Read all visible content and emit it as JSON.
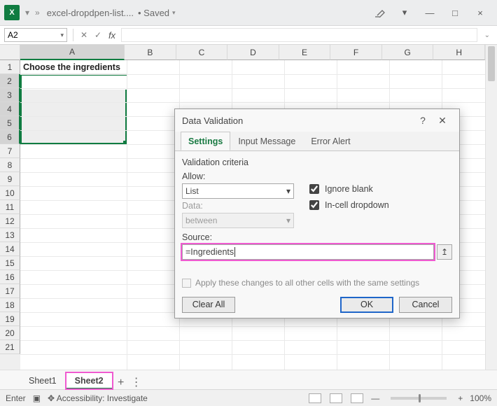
{
  "titlebar": {
    "filename": "excel-dropdpen-list....",
    "status": "Saved"
  },
  "titlebuttons": {
    "min": "—",
    "max": "□",
    "close": "×"
  },
  "namebox": "A2",
  "columns": [
    "A",
    "B",
    "C",
    "D",
    "E",
    "F",
    "G",
    "H"
  ],
  "cellA1": "Choose the ingredients",
  "tabs": {
    "sheet1": "Sheet1",
    "sheet2": "Sheet2"
  },
  "status": {
    "mode": "Enter",
    "access": "Accessibility: Investigate",
    "zoom": "100%"
  },
  "dlg": {
    "title": "Data Validation",
    "tabs": {
      "settings": "Settings",
      "input": "Input Message",
      "error": "Error Alert"
    },
    "criteria": "Validation criteria",
    "allow_label": "Allow:",
    "allow_value": "List",
    "data_label": "Data:",
    "data_value": "between",
    "ignore": "Ignore blank",
    "incell": "In-cell dropdown",
    "source_label": "Source:",
    "source_value": "=Ingredients",
    "apply": "Apply these changes to all other cells with the same settings",
    "clear": "Clear All",
    "ok": "OK",
    "cancel": "Cancel",
    "help": "?",
    "close": "✕"
  }
}
